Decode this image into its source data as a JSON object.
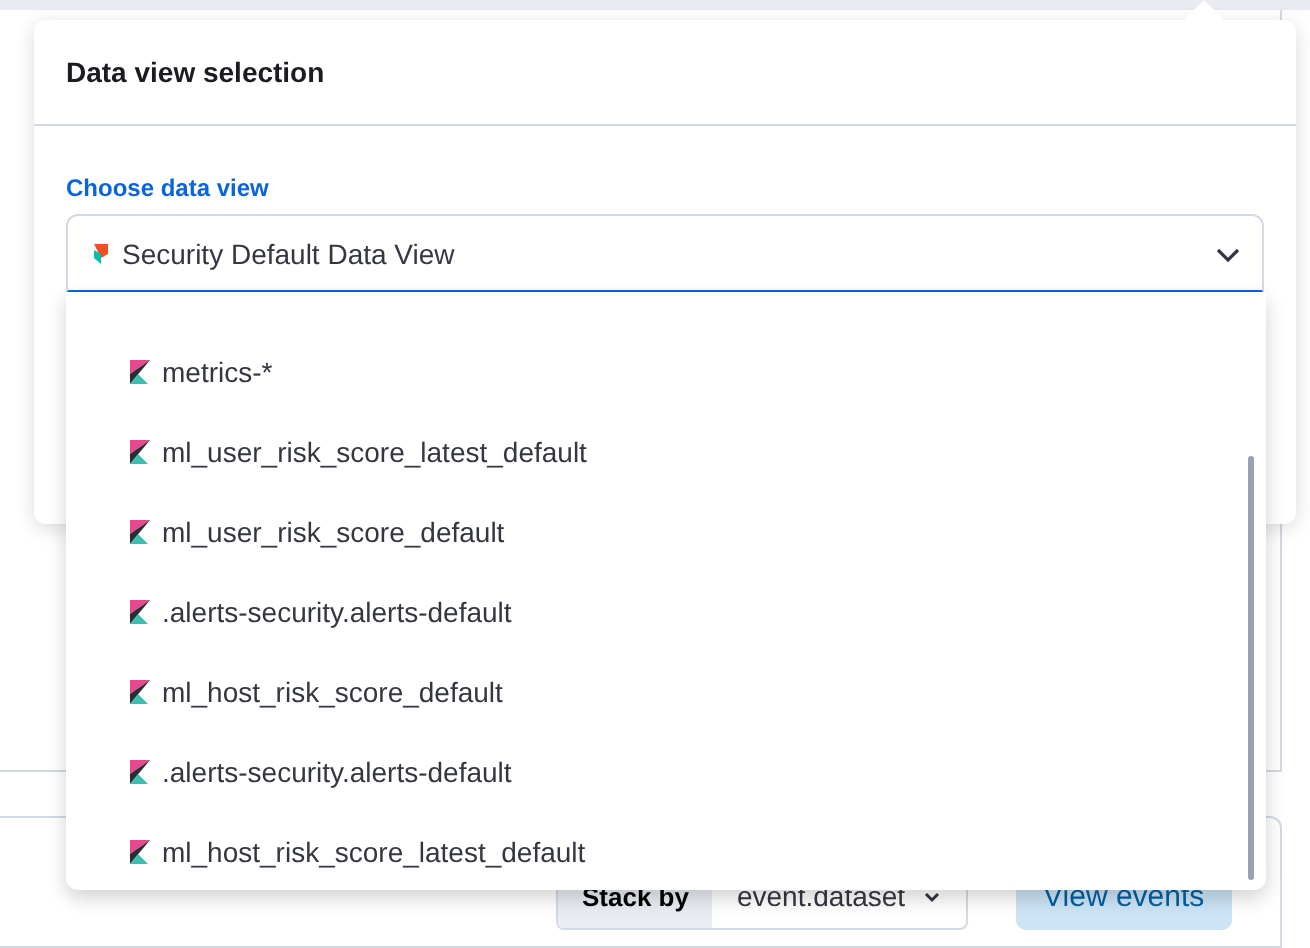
{
  "background": {
    "stack_by_label": "Stack by",
    "stack_by_value": "event.dataset",
    "view_events_button": "View events"
  },
  "popover": {
    "title": "Data view selection",
    "field_label": "Choose data view",
    "selected_view": "Security Default Data View",
    "options": [
      {
        "label": "metrics-*",
        "selected": false
      },
      {
        "label": "ml_user_risk_score_latest_default",
        "selected": false
      },
      {
        "label": "ml_user_risk_score_default",
        "selected": false
      },
      {
        "label": ".alerts-security.alerts-default",
        "selected": false
      },
      {
        "label": "ml_host_risk_score_default",
        "selected": false
      },
      {
        "label": ".alerts-security.alerts-default",
        "selected": false
      },
      {
        "label": "ml_host_risk_score_latest_default",
        "selected": false
      }
    ]
  }
}
